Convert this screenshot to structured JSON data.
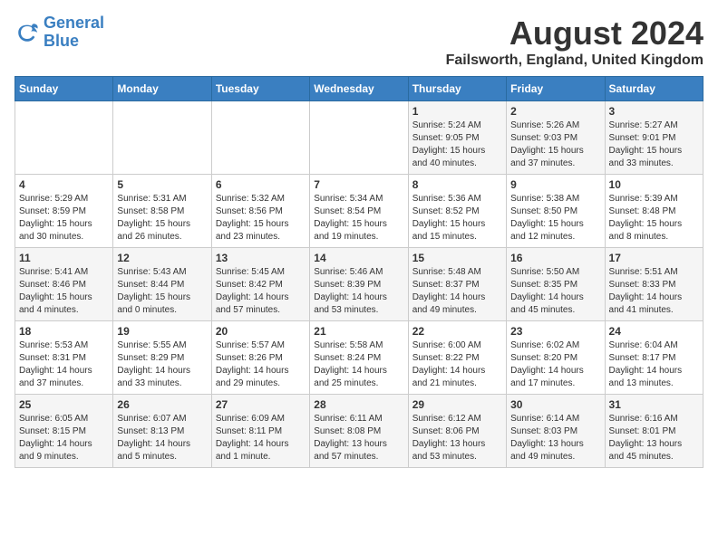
{
  "logo": {
    "line1": "General",
    "line2": "Blue"
  },
  "title": "August 2024",
  "subtitle": "Failsworth, England, United Kingdom",
  "days_of_week": [
    "Sunday",
    "Monday",
    "Tuesday",
    "Wednesday",
    "Thursday",
    "Friday",
    "Saturday"
  ],
  "weeks": [
    [
      {
        "day": "",
        "info": ""
      },
      {
        "day": "",
        "info": ""
      },
      {
        "day": "",
        "info": ""
      },
      {
        "day": "",
        "info": ""
      },
      {
        "day": "1",
        "info": "Sunrise: 5:24 AM\nSunset: 9:05 PM\nDaylight: 15 hours\nand 40 minutes."
      },
      {
        "day": "2",
        "info": "Sunrise: 5:26 AM\nSunset: 9:03 PM\nDaylight: 15 hours\nand 37 minutes."
      },
      {
        "day": "3",
        "info": "Sunrise: 5:27 AM\nSunset: 9:01 PM\nDaylight: 15 hours\nand 33 minutes."
      }
    ],
    [
      {
        "day": "4",
        "info": "Sunrise: 5:29 AM\nSunset: 8:59 PM\nDaylight: 15 hours\nand 30 minutes."
      },
      {
        "day": "5",
        "info": "Sunrise: 5:31 AM\nSunset: 8:58 PM\nDaylight: 15 hours\nand 26 minutes."
      },
      {
        "day": "6",
        "info": "Sunrise: 5:32 AM\nSunset: 8:56 PM\nDaylight: 15 hours\nand 23 minutes."
      },
      {
        "day": "7",
        "info": "Sunrise: 5:34 AM\nSunset: 8:54 PM\nDaylight: 15 hours\nand 19 minutes."
      },
      {
        "day": "8",
        "info": "Sunrise: 5:36 AM\nSunset: 8:52 PM\nDaylight: 15 hours\nand 15 minutes."
      },
      {
        "day": "9",
        "info": "Sunrise: 5:38 AM\nSunset: 8:50 PM\nDaylight: 15 hours\nand 12 minutes."
      },
      {
        "day": "10",
        "info": "Sunrise: 5:39 AM\nSunset: 8:48 PM\nDaylight: 15 hours\nand 8 minutes."
      }
    ],
    [
      {
        "day": "11",
        "info": "Sunrise: 5:41 AM\nSunset: 8:46 PM\nDaylight: 15 hours\nand 4 minutes."
      },
      {
        "day": "12",
        "info": "Sunrise: 5:43 AM\nSunset: 8:44 PM\nDaylight: 15 hours\nand 0 minutes."
      },
      {
        "day": "13",
        "info": "Sunrise: 5:45 AM\nSunset: 8:42 PM\nDaylight: 14 hours\nand 57 minutes."
      },
      {
        "day": "14",
        "info": "Sunrise: 5:46 AM\nSunset: 8:39 PM\nDaylight: 14 hours\nand 53 minutes."
      },
      {
        "day": "15",
        "info": "Sunrise: 5:48 AM\nSunset: 8:37 PM\nDaylight: 14 hours\nand 49 minutes."
      },
      {
        "day": "16",
        "info": "Sunrise: 5:50 AM\nSunset: 8:35 PM\nDaylight: 14 hours\nand 45 minutes."
      },
      {
        "day": "17",
        "info": "Sunrise: 5:51 AM\nSunset: 8:33 PM\nDaylight: 14 hours\nand 41 minutes."
      }
    ],
    [
      {
        "day": "18",
        "info": "Sunrise: 5:53 AM\nSunset: 8:31 PM\nDaylight: 14 hours\nand 37 minutes."
      },
      {
        "day": "19",
        "info": "Sunrise: 5:55 AM\nSunset: 8:29 PM\nDaylight: 14 hours\nand 33 minutes."
      },
      {
        "day": "20",
        "info": "Sunrise: 5:57 AM\nSunset: 8:26 PM\nDaylight: 14 hours\nand 29 minutes."
      },
      {
        "day": "21",
        "info": "Sunrise: 5:58 AM\nSunset: 8:24 PM\nDaylight: 14 hours\nand 25 minutes."
      },
      {
        "day": "22",
        "info": "Sunrise: 6:00 AM\nSunset: 8:22 PM\nDaylight: 14 hours\nand 21 minutes."
      },
      {
        "day": "23",
        "info": "Sunrise: 6:02 AM\nSunset: 8:20 PM\nDaylight: 14 hours\nand 17 minutes."
      },
      {
        "day": "24",
        "info": "Sunrise: 6:04 AM\nSunset: 8:17 PM\nDaylight: 14 hours\nand 13 minutes."
      }
    ],
    [
      {
        "day": "25",
        "info": "Sunrise: 6:05 AM\nSunset: 8:15 PM\nDaylight: 14 hours\nand 9 minutes."
      },
      {
        "day": "26",
        "info": "Sunrise: 6:07 AM\nSunset: 8:13 PM\nDaylight: 14 hours\nand 5 minutes."
      },
      {
        "day": "27",
        "info": "Sunrise: 6:09 AM\nSunset: 8:11 PM\nDaylight: 14 hours\nand 1 minute."
      },
      {
        "day": "28",
        "info": "Sunrise: 6:11 AM\nSunset: 8:08 PM\nDaylight: 13 hours\nand 57 minutes."
      },
      {
        "day": "29",
        "info": "Sunrise: 6:12 AM\nSunset: 8:06 PM\nDaylight: 13 hours\nand 53 minutes."
      },
      {
        "day": "30",
        "info": "Sunrise: 6:14 AM\nSunset: 8:03 PM\nDaylight: 13 hours\nand 49 minutes."
      },
      {
        "day": "31",
        "info": "Sunrise: 6:16 AM\nSunset: 8:01 PM\nDaylight: 13 hours\nand 45 minutes."
      }
    ]
  ]
}
